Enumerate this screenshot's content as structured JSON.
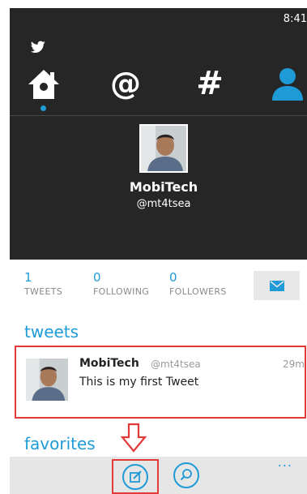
{
  "status_bar": {
    "time": "8:41"
  },
  "nav": {
    "items": [
      {
        "name": "home",
        "active": true
      },
      {
        "name": "mentions",
        "glyph": "@"
      },
      {
        "name": "hashtags",
        "glyph": "#"
      },
      {
        "name": "profile"
      }
    ]
  },
  "profile": {
    "name": "MobiTech",
    "handle": "@mt4tsea"
  },
  "stats": {
    "tweets_count": "1",
    "tweets_label": "TWEETS",
    "following_count": "0",
    "following_label": "FOLLOWING",
    "followers_count": "0",
    "followers_label": "FOLLOWERS"
  },
  "sections": {
    "tweets_title": "tweets",
    "favorites_title": "favorites"
  },
  "tweet": {
    "name": "MobiTech",
    "handle": "@mt4tsea",
    "time": "29m",
    "text": "This is my first Tweet"
  },
  "appbar": {
    "more": "..."
  },
  "colors": {
    "accent": "#1e9bd7",
    "header_bg": "#262626",
    "highlight": "#e23a3a",
    "appbar_bg": "#e6e6e6"
  },
  "icons": [
    "twitter-bird-icon",
    "home-icon",
    "at-icon",
    "hashtag-icon",
    "profile-icon",
    "mail-icon",
    "compose-icon",
    "search-icon",
    "down-arrow-icon",
    "more-icon"
  ]
}
